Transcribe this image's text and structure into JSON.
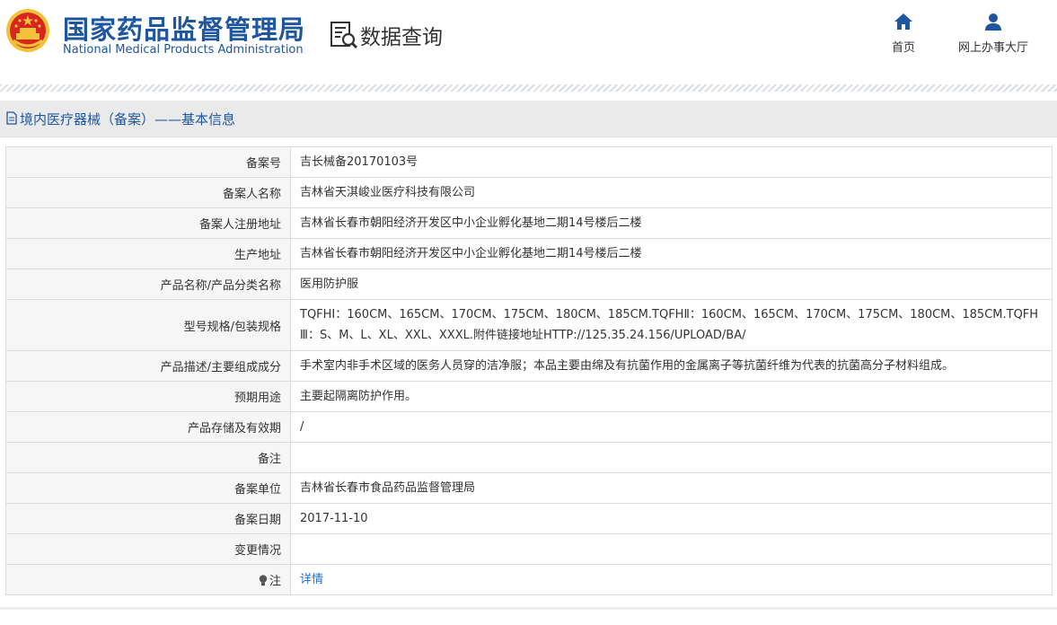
{
  "header": {
    "org_name_cn": "国家药品监督管理局",
    "org_name_en": "National Medical Products Administration",
    "section_title": "数据查询",
    "nav": [
      {
        "label": "首页",
        "icon": "home-icon"
      },
      {
        "label": "网上办事大厅",
        "icon": "user-icon"
      }
    ]
  },
  "page": {
    "title": "境内医疗器械（备案）——基本信息"
  },
  "colors": {
    "brand_blue": "#1e56a0",
    "link_blue": "#1e6fd6",
    "emblem_red": "#d7261d",
    "emblem_gold": "#f2c23a"
  },
  "table": {
    "rows": [
      {
        "label": "备案号",
        "value": "吉长械备20170103号"
      },
      {
        "label": "备案人名称",
        "value": "吉林省天淇峻业医疗科技有限公司"
      },
      {
        "label": "备案人注册地址",
        "value": "吉林省长春市朝阳经济开发区中小企业孵化基地二期14号楼后二楼"
      },
      {
        "label": "生产地址",
        "value": "吉林省长春市朝阳经济开发区中小企业孵化基地二期14号楼后二楼"
      },
      {
        "label": "产品名称/产品分类名称",
        "value": "医用防护服"
      },
      {
        "label": "型号规格/包装规格",
        "value": "TQFHⅠ：160CM、165CM、170CM、175CM、180CM、185CM.TQFHⅡ：160CM、165CM、170CM、175CM、180CM、185CM.TQFHⅢ：S、M、L、XL、XXL、XXXL.附件链接地址HTTP://125.35.24.156/UPLOAD/BA/"
      },
      {
        "label": "产品描述/主要组成成分",
        "value": "手术室内非手术区域的医务人员穿的洁净服；本品主要由绵及有抗菌作用的金属离子等抗菌纤维为代表的抗菌高分子材料组成。"
      },
      {
        "label": "预期用途",
        "value": "主要起隔离防护作用。"
      },
      {
        "label": "产品存储及有效期",
        "value": "/"
      },
      {
        "label": "备注",
        "value": ""
      },
      {
        "label": "备案单位",
        "value": "吉林省长春市食品药品监督管理局"
      },
      {
        "label": "备案日期",
        "value": "2017-11-10"
      },
      {
        "label": "变更情况",
        "value": ""
      },
      {
        "label": "注",
        "value": "详情",
        "icon": "lightbulb-icon"
      }
    ]
  }
}
